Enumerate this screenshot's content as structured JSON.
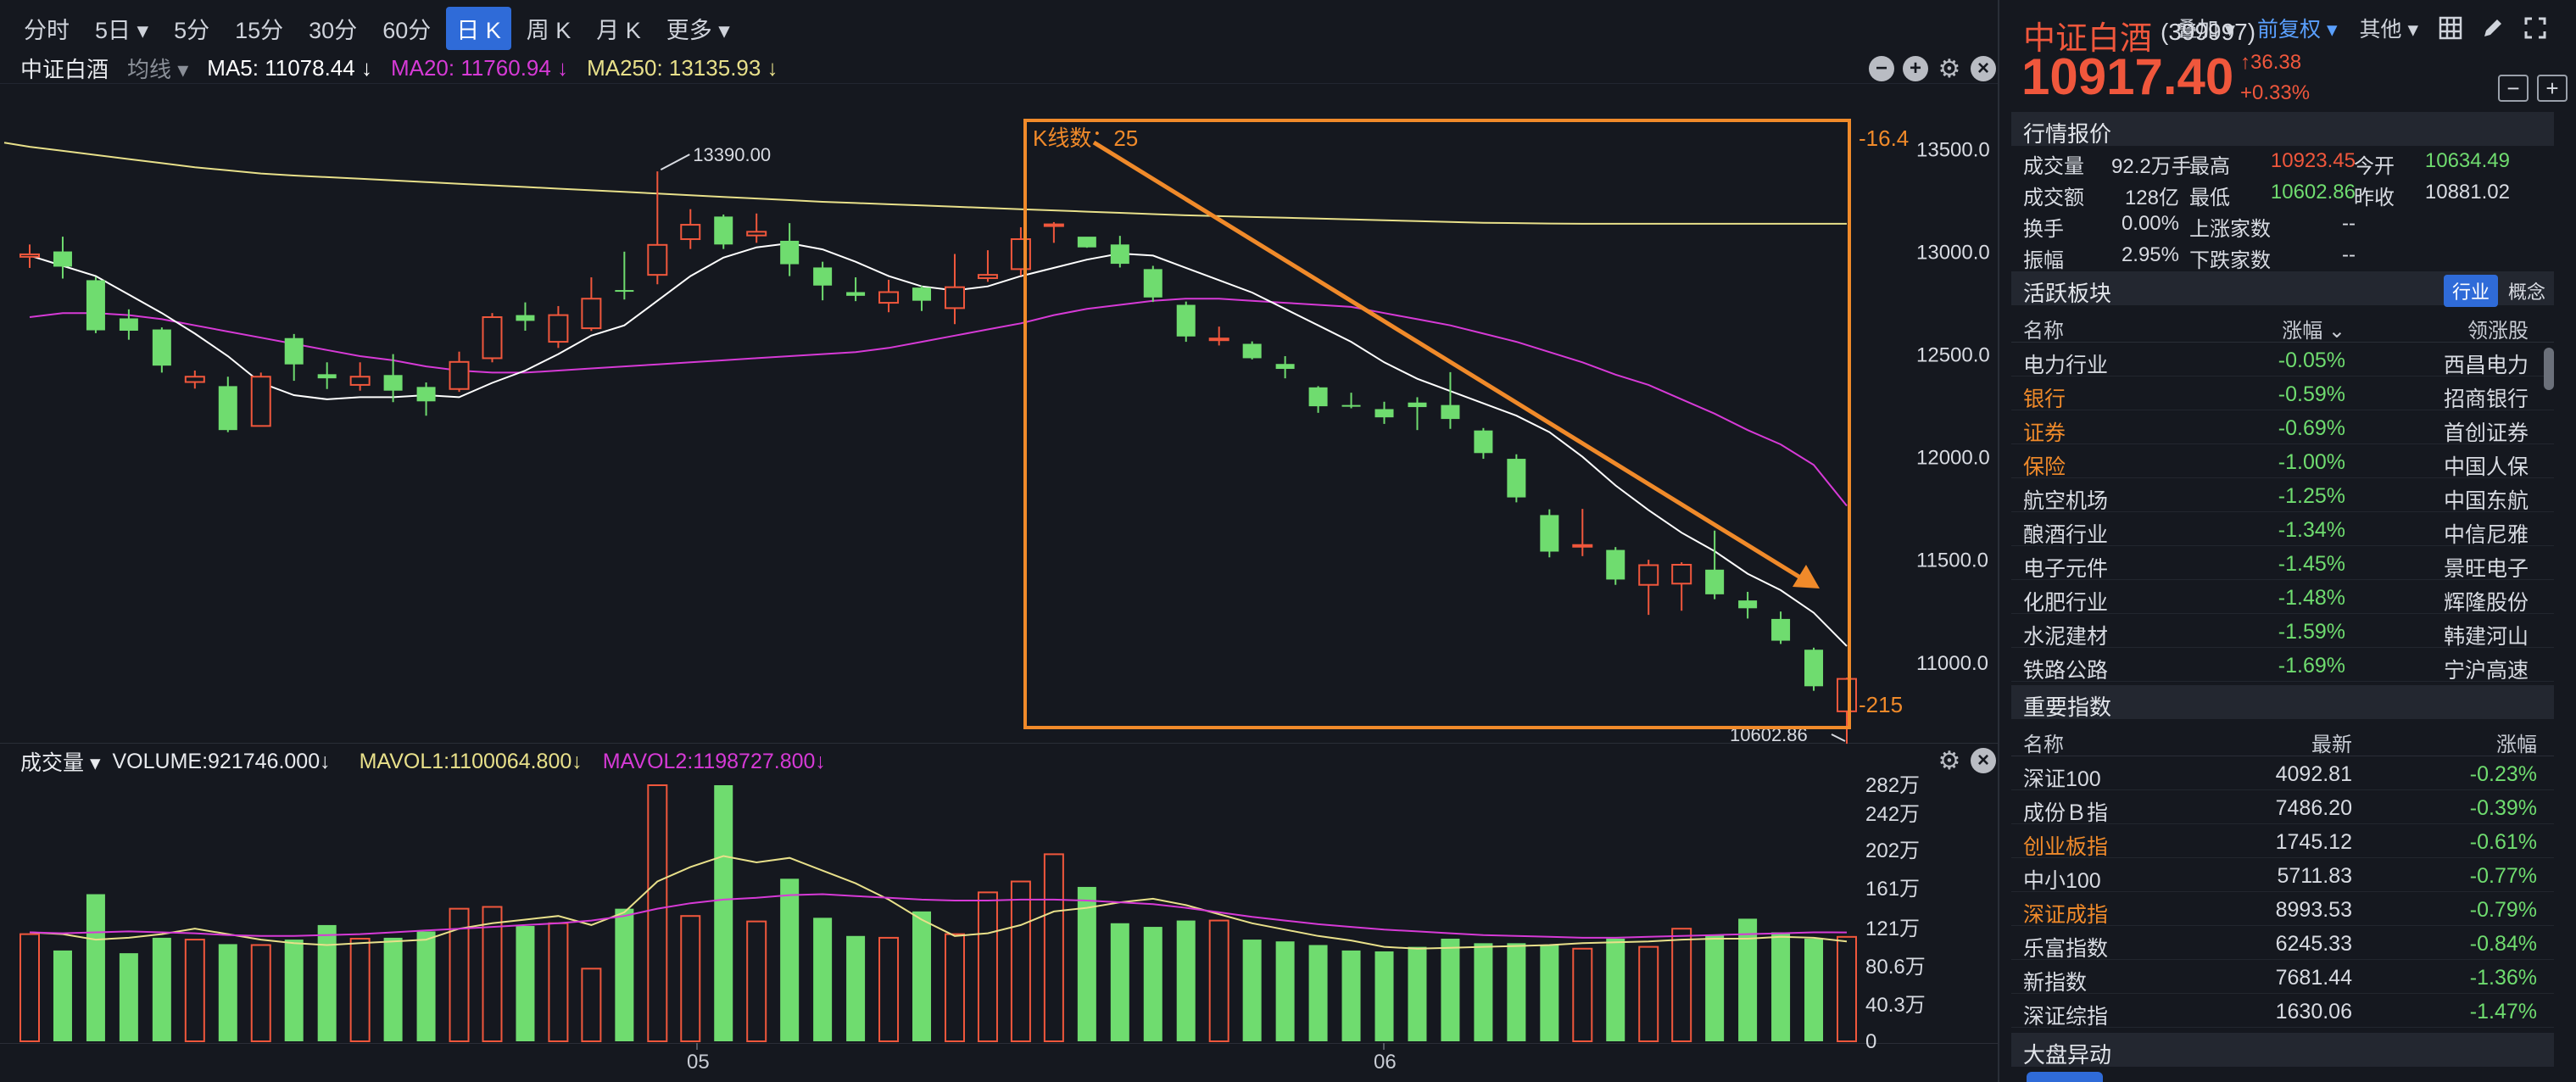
{
  "toolbar": {
    "timeframes": [
      "分时",
      "5日 ▾",
      "5分",
      "15分",
      "30分",
      "60分",
      "日 K",
      "周 K",
      "月 K",
      "更多 ▾"
    ],
    "active_index": 6,
    "right": [
      "叠加 ▾",
      "前复权 ▾",
      "其他 ▾"
    ]
  },
  "legend": {
    "name": "中证白酒",
    "ma_type": "均线 ▾",
    "ma5": "MA5: 11078.44 ↓",
    "ma20": "MA20: 11760.94 ↓",
    "ma250": "MA250: 13135.93 ↓"
  },
  "colors": {
    "up": "#f0573c",
    "down": "#6fdc6f",
    "ma5": "#ffffff",
    "ma20": "#d63ad6",
    "ma250": "#e8e08a",
    "annotation": "#f08a2a",
    "accent": "#2f6bd8"
  },
  "price_axis": [
    "13500.0",
    "13000.0",
    "12500.0",
    "12000.0",
    "11500.0",
    "11000.0"
  ],
  "annotation": {
    "count_label": "K线数：25",
    "right_top": "-16.4",
    "right_bottom": "-215",
    "high_label": "13390.00",
    "low_label": "10602.86"
  },
  "volume_legend": {
    "name": "成交量 ▾",
    "volume": "VOLUME:921746.000↓",
    "mavol1": "MAVOL1:1100064.800↓",
    "mavol2": "MAVOL2:1198727.800↓"
  },
  "volume_axis": [
    "282万",
    "242万",
    "202万",
    "161万",
    "121万",
    "80.6万",
    "40.3万",
    "0"
  ],
  "date_axis": [
    "05",
    "06"
  ],
  "candles": [
    [
      12974,
      12986,
      12920,
      13034
    ],
    [
      13000,
      12926,
      12868,
      13072
    ],
    [
      12860,
      12616,
      12602,
      12876
    ],
    [
      12674,
      12614,
      12570,
      12718
    ],
    [
      12620,
      12444,
      12410,
      12630
    ],
    [
      12364,
      12390,
      12332,
      12420
    ],
    [
      12344,
      12130,
      12120,
      12390
    ],
    [
      12150,
      12390,
      12150,
      12410
    ],
    [
      12578,
      12450,
      12370,
      12598
    ],
    [
      12402,
      12382,
      12330,
      12460
    ],
    [
      12350,
      12390,
      12322,
      12460
    ],
    [
      12398,
      12322,
      12266,
      12500
    ],
    [
      12340,
      12270,
      12200,
      12362
    ],
    [
      12330,
      12462,
      12316,
      12512
    ],
    [
      12480,
      12680,
      12460,
      12700
    ],
    [
      12690,
      12662,
      12614,
      12752
    ],
    [
      12560,
      12690,
      12530,
      12734
    ],
    [
      12626,
      12770,
      12613,
      12874
    ],
    [
      12812,
      12808,
      12766,
      12999
    ],
    [
      12886,
      13032,
      12840,
      13390
    ],
    [
      13060,
      13130,
      13012,
      13206
    ],
    [
      13170,
      13034,
      13012,
      13180
    ],
    [
      13078,
      13096,
      13042,
      13185
    ],
    [
      13052,
      12938,
      12880,
      13138
    ],
    [
      12922,
      12834,
      12762,
      12950
    ],
    [
      12802,
      12784,
      12758,
      12874
    ],
    [
      12750,
      12802,
      12704,
      12862
    ],
    [
      12824,
      12760,
      12710,
      12832
    ],
    [
      12724,
      12826,
      12646,
      12988
    ],
    [
      12870,
      12886,
      12852,
      13006
    ],
    [
      12914,
      13060,
      12882,
      13118
    ],
    [
      13130,
      13132,
      13042,
      13143
    ],
    [
      13072,
      13020,
      13018,
      13065
    ],
    [
      13034,
      12940,
      12922,
      13076
    ],
    [
      12914,
      12776,
      12754,
      12930
    ],
    [
      12740,
      12586,
      12560,
      12756
    ],
    [
      12572,
      12576,
      12542,
      12634
    ],
    [
      12550,
      12480,
      12474,
      12562
    ],
    [
      12452,
      12428,
      12382,
      12490
    ],
    [
      12338,
      12246,
      12214,
      12344
    ],
    [
      12252,
      12244,
      12236,
      12312
    ],
    [
      12232,
      12192,
      12160,
      12268
    ],
    [
      12264,
      12242,
      12130,
      12290
    ],
    [
      12252,
      12184,
      12136,
      12412
    ],
    [
      12128,
      12018,
      11990,
      12140
    ],
    [
      11990,
      11802,
      11778,
      12012
    ],
    [
      11716,
      11538,
      11510,
      11744
    ],
    [
      11566,
      11570,
      11516,
      11746
    ],
    [
      11546,
      11402,
      11376,
      11560
    ],
    [
      11376,
      11472,
      11230,
      11498
    ],
    [
      11382,
      11474,
      11250,
      11486
    ],
    [
      11450,
      11330,
      11306,
      11640
    ],
    [
      11300,
      11262,
      11212,
      11342
    ],
    [
      11210,
      11104,
      11088,
      11246
    ],
    [
      11060,
      10882,
      10860,
      11070
    ],
    [
      10760,
      10918,
      10602,
      10924
    ]
  ],
  "ma5": [
    12980,
    12930,
    12880,
    12790,
    12700,
    12600,
    12490,
    12360,
    12300,
    12280,
    12290,
    12290,
    12300,
    12290,
    12360,
    12420,
    12500,
    12590,
    12640,
    12760,
    12880,
    12970,
    13020,
    13040,
    13010,
    12950,
    12880,
    12830,
    12810,
    12830,
    12880,
    12920,
    12960,
    12990,
    12980,
    12920,
    12860,
    12800,
    12720,
    12640,
    12560,
    12460,
    12380,
    12320,
    12260,
    12200,
    12120,
    12000,
    11860,
    11740,
    11630,
    11540,
    11430,
    11350,
    11240,
    11078
  ],
  "ma20": [
    12680,
    12700,
    12700,
    12690,
    12670,
    12640,
    12610,
    12580,
    12550,
    12520,
    12490,
    12470,
    12440,
    12420,
    12410,
    12410,
    12420,
    12430,
    12440,
    12450,
    12460,
    12470,
    12480,
    12490,
    12500,
    12510,
    12530,
    12560,
    12590,
    12620,
    12650,
    12690,
    12720,
    12740,
    12760,
    12770,
    12770,
    12760,
    12750,
    12740,
    12730,
    12700,
    12670,
    12640,
    12600,
    12560,
    12510,
    12460,
    12400,
    12350,
    12280,
    12210,
    12130,
    12060,
    11960,
    11761
  ],
  "ma250": [
    13510,
    13490,
    13470,
    13450,
    13430,
    13410,
    13395,
    13380,
    13370,
    13362,
    13354,
    13346,
    13338,
    13330,
    13322,
    13314,
    13306,
    13298,
    13290,
    13282,
    13274,
    13266,
    13258,
    13250,
    13242,
    13236,
    13230,
    13224,
    13218,
    13212,
    13206,
    13200,
    13194,
    13188,
    13182,
    13176,
    13172,
    13168,
    13164,
    13160,
    13156,
    13152,
    13148,
    13144,
    13140,
    13138,
    13136,
    13135,
    13135,
    13135,
    13135,
    13135,
    13135,
    13135,
    13135,
    13135
  ],
  "volume": [
    1180000,
    1000000,
    1620000,
    970000,
    1140000,
    1120000,
    1070000,
    1060000,
    1120000,
    1280000,
    1130000,
    1140000,
    1210000,
    1460000,
    1480000,
    1270000,
    1300000,
    800000,
    1460000,
    2820000,
    1380000,
    2820000,
    1320000,
    1790000,
    1360000,
    1160000,
    1140000,
    1430000,
    1180000,
    1640000,
    1760000,
    2060000,
    1700000,
    1300000,
    1260000,
    1330000,
    1330000,
    1120000,
    1100000,
    1060000,
    1000000,
    990000,
    1040000,
    1130000,
    1080000,
    1080000,
    1060000,
    1020000,
    1130000,
    1040000,
    1240000,
    1170000,
    1350000,
    1200000,
    1130000,
    1150000
  ],
  "mavol1": [
    1200000,
    1180000,
    1120000,
    1140000,
    1180000,
    1240000,
    1180000,
    1120000,
    1080000,
    1060000,
    1080000,
    1100000,
    1120000,
    1240000,
    1300000,
    1340000,
    1380000,
    1280000,
    1420000,
    1760000,
    1920000,
    2040000,
    1970000,
    2020000,
    1880000,
    1740000,
    1560000,
    1340000,
    1160000,
    1190000,
    1280000,
    1430000,
    1470000,
    1530000,
    1570000,
    1500000,
    1400000,
    1300000,
    1230000,
    1160000,
    1110000,
    1040000,
    1020000,
    1030000,
    1040000,
    1050000,
    1060000,
    1080000,
    1090000,
    1100000,
    1120000,
    1130000,
    1130000,
    1150000,
    1140000,
    1100000
  ],
  "mavol2": [
    1200000,
    1190000,
    1200000,
    1210000,
    1200000,
    1190000,
    1170000,
    1160000,
    1160000,
    1170000,
    1180000,
    1200000,
    1220000,
    1240000,
    1260000,
    1280000,
    1300000,
    1330000,
    1380000,
    1460000,
    1520000,
    1560000,
    1580000,
    1610000,
    1620000,
    1600000,
    1580000,
    1560000,
    1550000,
    1550000,
    1560000,
    1560000,
    1550000,
    1530000,
    1510000,
    1470000,
    1420000,
    1370000,
    1330000,
    1290000,
    1260000,
    1230000,
    1210000,
    1190000,
    1170000,
    1160000,
    1150000,
    1140000,
    1140000,
    1150000,
    1160000,
    1170000,
    1180000,
    1190000,
    1200000,
    1198727
  ],
  "right": {
    "title": "中证白酒",
    "code": "(399997)",
    "price": "10917.40",
    "change": "↑36.38",
    "change_pct": "+0.33%",
    "quote_header": "行情报价",
    "quote": [
      [
        [
          "成交量",
          "#d8dbe2"
        ],
        [
          "92.2万手",
          "#d8dbe2"
        ],
        [
          "最高",
          "#d8dbe2"
        ],
        [
          "10923.45",
          "#f0573c"
        ],
        [
          "今开",
          "#d8dbe2"
        ],
        [
          "10634.49",
          "#6fdc6f"
        ]
      ],
      [
        [
          "成交额",
          "#d8dbe2"
        ],
        [
          "128亿",
          "#d8dbe2"
        ],
        [
          "最低",
          "#d8dbe2"
        ],
        [
          "10602.86",
          "#6fdc6f"
        ],
        [
          "昨收",
          "#d8dbe2"
        ],
        [
          "10881.02",
          "#d8dbe2"
        ]
      ],
      [
        [
          "换手",
          "#d8dbe2"
        ],
        [
          "0.00%",
          "#d8dbe2"
        ],
        [
          "上涨家数",
          "#d8dbe2"
        ],
        [
          "--",
          "#d8dbe2"
        ],
        [
          "",
          ""
        ],
        [
          "",
          ""
        ]
      ],
      [
        [
          "振幅",
          "#d8dbe2"
        ],
        [
          "2.95%",
          "#d8dbe2"
        ],
        [
          "下跌家数",
          "#d8dbe2"
        ],
        [
          "--",
          "#d8dbe2"
        ],
        [
          "",
          ""
        ],
        [
          "",
          ""
        ]
      ]
    ],
    "sector_header": "活跃板块",
    "sector_tab1": "行业",
    "sector_tab2": "概念",
    "sector_cols": [
      "名称",
      "涨幅 ⌄",
      "领涨股"
    ],
    "sectors": [
      [
        "电力行业",
        "-0.05%",
        "西昌电力",
        "#d8dbe2"
      ],
      [
        "银行",
        "-0.59%",
        "招商银行",
        "#f08a2a"
      ],
      [
        "证券",
        "-0.69%",
        "首创证券",
        "#f08a2a"
      ],
      [
        "保险",
        "-1.00%",
        "中国人保",
        "#f08a2a"
      ],
      [
        "航空机场",
        "-1.25%",
        "中国东航",
        "#d8dbe2"
      ],
      [
        "酿酒行业",
        "-1.34%",
        "中信尼雅",
        "#d8dbe2"
      ],
      [
        "电子元件",
        "-1.45%",
        "景旺电子",
        "#d8dbe2"
      ],
      [
        "化肥行业",
        "-1.48%",
        "辉隆股份",
        "#d8dbe2"
      ],
      [
        "水泥建材",
        "-1.59%",
        "韩建河山",
        "#d8dbe2"
      ],
      [
        "铁路公路",
        "-1.69%",
        "宁沪高速",
        "#d8dbe2"
      ]
    ],
    "index_header": "重要指数",
    "index_cols": [
      "名称",
      "最新",
      "涨幅"
    ],
    "indices": [
      [
        "深证100",
        "4092.81",
        "-0.23%",
        "#d8dbe2"
      ],
      [
        "成份Ｂ指",
        "7486.20",
        "-0.39%",
        "#d8dbe2"
      ],
      [
        "创业板指",
        "1745.12",
        "-0.61%",
        "#f08a2a"
      ],
      [
        "中小100",
        "5711.83",
        "-0.77%",
        "#d8dbe2"
      ],
      [
        "深证成指",
        "8993.53",
        "-0.79%",
        "#f08a2a"
      ],
      [
        "乐富指数",
        "6245.33",
        "-0.84%",
        "#d8dbe2"
      ],
      [
        "新指数",
        "7681.44",
        "-1.36%",
        "#d8dbe2"
      ],
      [
        "深证综指",
        "1630.06",
        "-1.47%",
        "#d8dbe2"
      ]
    ],
    "bottom_header": "大盘异动"
  }
}
